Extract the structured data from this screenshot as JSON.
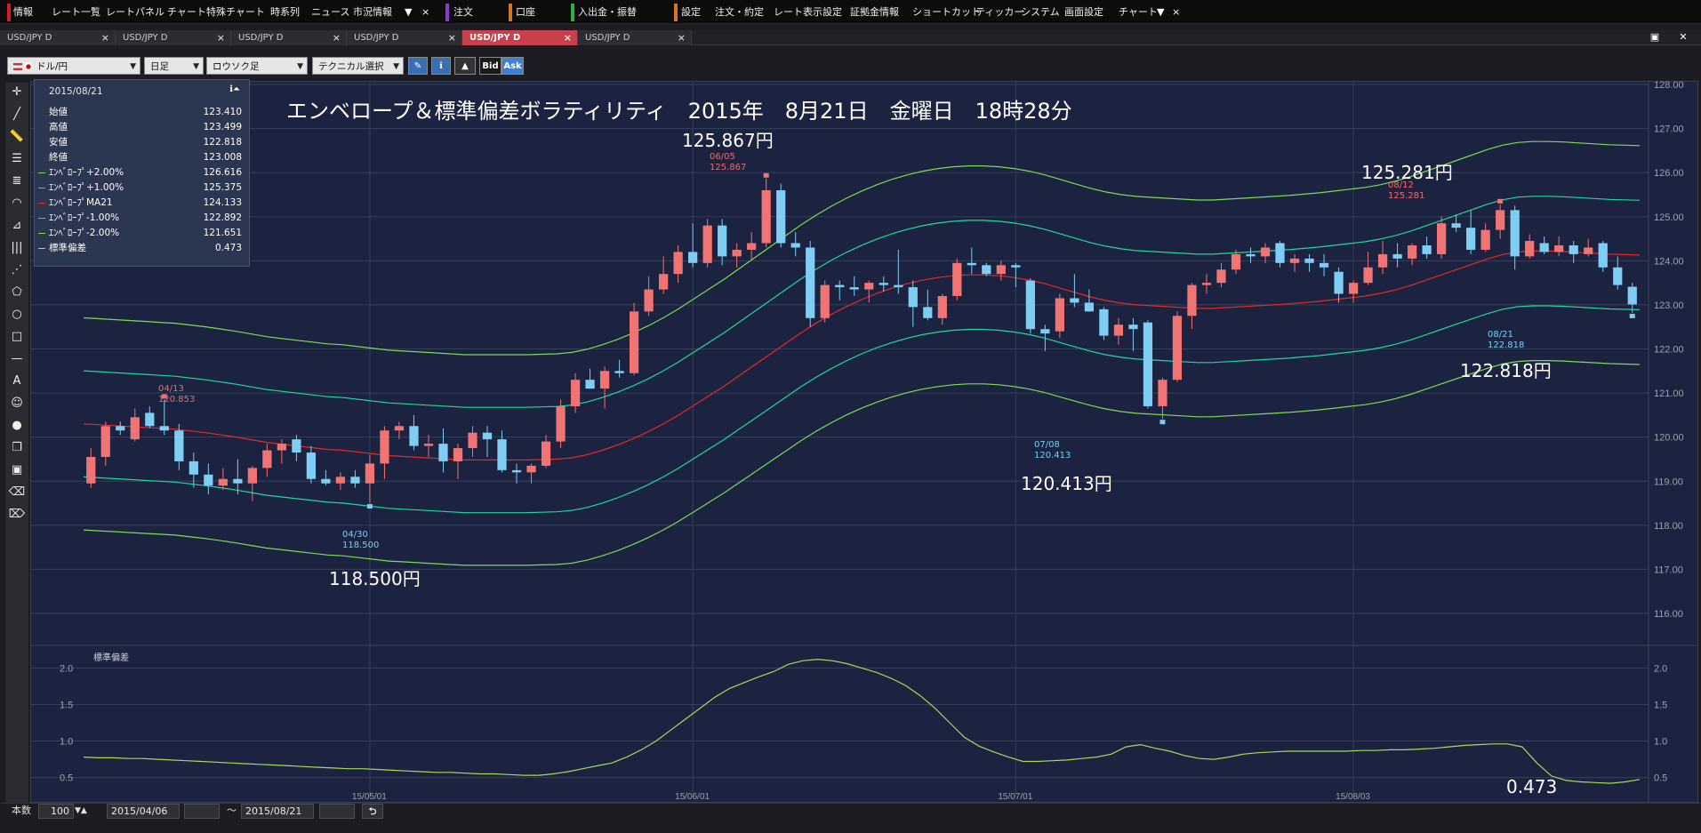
{
  "menubar": {
    "items": [
      "情報",
      "レート一覧",
      "レートパネル",
      "チャート",
      "特殊チャート",
      "時系列",
      "ニュース",
      "市況情報",
      "注文",
      "口座",
      "入出金・振替",
      "設定",
      "注文・約定",
      "レート表示設定",
      "証拠金情報",
      "ショートカット",
      "ティッカー",
      "システム",
      "画面設定",
      "チャート"
    ],
    "overflow_icon": "▼",
    "close_icon": "×"
  },
  "tabs": [
    {
      "label": "USD/JPY D",
      "active": false
    },
    {
      "label": "USD/JPY D",
      "active": false
    },
    {
      "label": "USD/JPY D",
      "active": false
    },
    {
      "label": "USD/JPY D",
      "active": false
    },
    {
      "label": "USD/JPY D",
      "active": true
    },
    {
      "label": "USD/JPY D",
      "active": false
    }
  ],
  "tab_close": "×",
  "toolbar": {
    "currency_pair": "ドル/円",
    "timeframe": "日足",
    "chart_style": "ロウソク足",
    "technical": "テクニカル選択",
    "bid": "Bid",
    "ask": "Ask"
  },
  "info_panel": {
    "date": "2015/08/21",
    "rows": [
      {
        "label": "始値",
        "value": "123.410",
        "color": ""
      },
      {
        "label": "高値",
        "value": "123.499",
        "color": ""
      },
      {
        "label": "安値",
        "value": "122.818",
        "color": ""
      },
      {
        "label": "終値",
        "value": "123.008",
        "color": ""
      },
      {
        "label": "ｴﾝﾍﾞﾛｰﾌﾟ+2.00%",
        "value": "126.616",
        "color": "#7ed957"
      },
      {
        "label": "ｴﾝﾍﾞﾛｰﾌﾟ+1.00%",
        "value": "125.375",
        "color": "#22d6a0"
      },
      {
        "label": "ｴﾝﾍﾞﾛｰﾌﾟMA21",
        "value": "124.133",
        "color": "#e02a2a"
      },
      {
        "label": "ｴﾝﾍﾞﾛｰﾌﾟ-1.00%",
        "value": "122.892",
        "color": "#22d6a0"
      },
      {
        "label": "ｴﾝﾍﾞﾛｰﾌﾟ-2.00%",
        "value": "121.651",
        "color": "#7ed957"
      },
      {
        "label": "標準偏差",
        "value": "0.473",
        "color": "#a9d85a"
      }
    ]
  },
  "title": "エンベロープ＆標準偏差ボラティリティ　2015年　8月21日　金曜日　18時28分",
  "annotations": {
    "high_0605": {
      "text": "125.867円",
      "date": "06/05",
      "price": "125.867"
    },
    "high_0812": {
      "text": "125.281円",
      "date": "08/12",
      "price": "125.281"
    },
    "high_0413": {
      "date": "04/13",
      "price": "120.853"
    },
    "low_0430": {
      "text": "118.500円",
      "date": "04/30",
      "price": "118.500"
    },
    "low_0708": {
      "text": "120.413円",
      "date": "07/08",
      "price": "120.413"
    },
    "last_0821": {
      "text": "122.818円",
      "date": "08/21",
      "price": "122.818"
    },
    "sd_last": {
      "text": "0.473"
    }
  },
  "sub_panel_label": "標準偏差",
  "statusbar": {
    "count_label": "本数",
    "count_value": "100",
    "start_date": "2015/04/06",
    "tilde": "～",
    "end_date": "2015/08/21"
  },
  "colors": {
    "background": "#1b2340",
    "up_candle": "#f07474",
    "down_candle": "#7fcdf2",
    "ma": "#e02a2a",
    "env1": "#22d6a0",
    "env2": "#7ed957",
    "sd": "#a9d85a"
  },
  "chart_data": {
    "type": "candlestick",
    "x_tick_labels": [
      "15/05/01",
      "15/06/01",
      "15/07/01",
      "15/08/03"
    ],
    "y_ticks_main": [
      "116.00",
      "117.00",
      "118.00",
      "119.00",
      "120.00",
      "121.00",
      "122.00",
      "123.00",
      "124.00",
      "125.00",
      "126.00",
      "127.00",
      "128.00"
    ],
    "ylim_main": [
      116,
      128
    ],
    "y_ticks_sub": [
      "0.5",
      "1.0",
      "1.5",
      "2.0"
    ],
    "ylim_sub": [
      0.3,
      2.2
    ],
    "ohlc": [
      {
        "o": 118.95,
        "h": 119.75,
        "l": 118.85,
        "c": 119.55
      },
      {
        "o": 119.55,
        "h": 120.35,
        "l": 119.35,
        "c": 120.25
      },
      {
        "o": 120.25,
        "h": 120.35,
        "l": 120.05,
        "c": 120.15
      },
      {
        "o": 119.95,
        "h": 120.65,
        "l": 119.9,
        "c": 120.45
      },
      {
        "o": 120.55,
        "h": 120.7,
        "l": 120.2,
        "c": 120.25
      },
      {
        "o": 120.25,
        "h": 120.85,
        "l": 120.05,
        "c": 120.15
      },
      {
        "o": 120.15,
        "h": 120.3,
        "l": 119.25,
        "c": 119.45
      },
      {
        "o": 119.45,
        "h": 119.65,
        "l": 118.85,
        "c": 119.15
      },
      {
        "o": 119.15,
        "h": 119.4,
        "l": 118.7,
        "c": 118.9
      },
      {
        "o": 118.9,
        "h": 119.3,
        "l": 118.8,
        "c": 119.05
      },
      {
        "o": 119.05,
        "h": 119.5,
        "l": 118.7,
        "c": 118.95
      },
      {
        "o": 118.95,
        "h": 119.35,
        "l": 118.55,
        "c": 119.3
      },
      {
        "o": 119.3,
        "h": 119.85,
        "l": 119.1,
        "c": 119.7
      },
      {
        "o": 119.7,
        "h": 119.95,
        "l": 119.4,
        "c": 119.85
      },
      {
        "o": 119.95,
        "h": 120.05,
        "l": 119.45,
        "c": 119.65
      },
      {
        "o": 119.65,
        "h": 119.8,
        "l": 118.95,
        "c": 119.05
      },
      {
        "o": 119.05,
        "h": 119.25,
        "l": 118.9,
        "c": 118.95
      },
      {
        "o": 118.95,
        "h": 119.2,
        "l": 118.8,
        "c": 119.1
      },
      {
        "o": 119.1,
        "h": 119.25,
        "l": 118.85,
        "c": 118.95
      },
      {
        "o": 118.95,
        "h": 119.6,
        "l": 118.5,
        "c": 119.4
      },
      {
        "o": 119.4,
        "h": 120.25,
        "l": 119.05,
        "c": 120.15
      },
      {
        "o": 120.15,
        "h": 120.35,
        "l": 119.95,
        "c": 120.25
      },
      {
        "o": 120.25,
        "h": 120.5,
        "l": 119.7,
        "c": 119.8
      },
      {
        "o": 119.8,
        "h": 120.05,
        "l": 119.55,
        "c": 119.85
      },
      {
        "o": 119.85,
        "h": 120.2,
        "l": 119.2,
        "c": 119.45
      },
      {
        "o": 119.45,
        "h": 119.85,
        "l": 119.05,
        "c": 119.75
      },
      {
        "o": 119.75,
        "h": 120.25,
        "l": 119.55,
        "c": 120.1
      },
      {
        "o": 120.1,
        "h": 120.25,
        "l": 119.55,
        "c": 119.95
      },
      {
        "o": 119.95,
        "h": 120.15,
        "l": 119.2,
        "c": 119.25
      },
      {
        "o": 119.25,
        "h": 119.4,
        "l": 118.95,
        "c": 119.2
      },
      {
        "o": 119.2,
        "h": 119.4,
        "l": 118.95,
        "c": 119.35
      },
      {
        "o": 119.35,
        "h": 120.05,
        "l": 119.3,
        "c": 119.9
      },
      {
        "o": 119.9,
        "h": 120.85,
        "l": 119.75,
        "c": 120.7
      },
      {
        "o": 120.7,
        "h": 121.45,
        "l": 120.55,
        "c": 121.3
      },
      {
        "o": 121.3,
        "h": 121.55,
        "l": 121.1,
        "c": 121.1
      },
      {
        "o": 121.1,
        "h": 121.6,
        "l": 120.65,
        "c": 121.5
      },
      {
        "o": 121.5,
        "h": 121.75,
        "l": 121.35,
        "c": 121.45
      },
      {
        "o": 121.45,
        "h": 123.05,
        "l": 121.4,
        "c": 122.85
      },
      {
        "o": 122.85,
        "h": 123.65,
        "l": 122.75,
        "c": 123.35
      },
      {
        "o": 123.35,
        "h": 124.1,
        "l": 123.25,
        "c": 123.7
      },
      {
        "o": 123.7,
        "h": 124.35,
        "l": 123.5,
        "c": 124.2
      },
      {
        "o": 124.2,
        "h": 124.85,
        "l": 123.85,
        "c": 123.95
      },
      {
        "o": 123.95,
        "h": 124.95,
        "l": 123.85,
        "c": 124.8
      },
      {
        "o": 124.8,
        "h": 124.95,
        "l": 123.9,
        "c": 124.1
      },
      {
        "o": 124.1,
        "h": 124.4,
        "l": 123.85,
        "c": 124.25
      },
      {
        "o": 124.25,
        "h": 124.65,
        "l": 124.0,
        "c": 124.4
      },
      {
        "o": 124.4,
        "h": 125.87,
        "l": 124.3,
        "c": 125.6
      },
      {
        "o": 125.6,
        "h": 125.75,
        "l": 124.3,
        "c": 124.4
      },
      {
        "o": 124.4,
        "h": 124.65,
        "l": 124.1,
        "c": 124.3
      },
      {
        "o": 124.3,
        "h": 124.45,
        "l": 122.5,
        "c": 122.7
      },
      {
        "o": 122.7,
        "h": 123.55,
        "l": 122.6,
        "c": 123.45
      },
      {
        "o": 123.45,
        "h": 123.55,
        "l": 123.1,
        "c": 123.4
      },
      {
        "o": 123.4,
        "h": 123.65,
        "l": 123.2,
        "c": 123.35
      },
      {
        "o": 123.35,
        "h": 123.55,
        "l": 123.05,
        "c": 123.5
      },
      {
        "o": 123.5,
        "h": 123.65,
        "l": 123.3,
        "c": 123.45
      },
      {
        "o": 123.45,
        "h": 124.25,
        "l": 123.25,
        "c": 123.4
      },
      {
        "o": 123.4,
        "h": 123.55,
        "l": 122.5,
        "c": 122.95
      },
      {
        "o": 122.95,
        "h": 123.35,
        "l": 122.65,
        "c": 122.7
      },
      {
        "o": 122.7,
        "h": 123.25,
        "l": 122.55,
        "c": 123.2
      },
      {
        "o": 123.2,
        "h": 124.05,
        "l": 123.1,
        "c": 123.95
      },
      {
        "o": 123.95,
        "h": 124.3,
        "l": 123.7,
        "c": 123.9
      },
      {
        "o": 123.9,
        "h": 123.95,
        "l": 123.65,
        "c": 123.7
      },
      {
        "o": 123.7,
        "h": 124.0,
        "l": 123.55,
        "c": 123.9
      },
      {
        "o": 123.9,
        "h": 123.95,
        "l": 123.4,
        "c": 123.85
      },
      {
        "o": 123.55,
        "h": 123.6,
        "l": 122.35,
        "c": 122.45
      },
      {
        "o": 122.45,
        "h": 122.55,
        "l": 121.95,
        "c": 122.35
      },
      {
        "o": 122.4,
        "h": 123.25,
        "l": 122.25,
        "c": 123.15
      },
      {
        "o": 123.15,
        "h": 123.7,
        "l": 122.95,
        "c": 123.05
      },
      {
        "o": 123.05,
        "h": 123.35,
        "l": 122.85,
        "c": 122.85
      },
      {
        "o": 122.9,
        "h": 122.95,
        "l": 122.2,
        "c": 122.3
      },
      {
        "o": 122.3,
        "h": 122.7,
        "l": 122.1,
        "c": 122.55
      },
      {
        "o": 122.55,
        "h": 122.7,
        "l": 121.95,
        "c": 122.45
      },
      {
        "o": 122.6,
        "h": 122.65,
        "l": 120.65,
        "c": 120.7
      },
      {
        "o": 120.7,
        "h": 121.35,
        "l": 120.41,
        "c": 121.3
      },
      {
        "o": 121.3,
        "h": 122.85,
        "l": 121.25,
        "c": 122.75
      },
      {
        "o": 122.75,
        "h": 123.5,
        "l": 122.45,
        "c": 123.45
      },
      {
        "o": 123.45,
        "h": 123.7,
        "l": 123.25,
        "c": 123.5
      },
      {
        "o": 123.5,
        "h": 123.95,
        "l": 123.4,
        "c": 123.8
      },
      {
        "o": 123.8,
        "h": 124.25,
        "l": 123.7,
        "c": 124.15
      },
      {
        "o": 124.15,
        "h": 124.3,
        "l": 123.95,
        "c": 124.1
      },
      {
        "o": 124.1,
        "h": 124.4,
        "l": 123.95,
        "c": 124.3
      },
      {
        "o": 124.4,
        "h": 124.45,
        "l": 123.85,
        "c": 123.95
      },
      {
        "o": 123.95,
        "h": 124.15,
        "l": 123.75,
        "c": 124.05
      },
      {
        "o": 124.05,
        "h": 124.15,
        "l": 123.75,
        "c": 123.95
      },
      {
        "o": 123.95,
        "h": 124.15,
        "l": 123.65,
        "c": 123.85
      },
      {
        "o": 123.75,
        "h": 123.85,
        "l": 123.05,
        "c": 123.25
      },
      {
        "o": 123.25,
        "h": 123.55,
        "l": 123.05,
        "c": 123.5
      },
      {
        "o": 123.5,
        "h": 124.2,
        "l": 123.45,
        "c": 123.85
      },
      {
        "o": 123.85,
        "h": 124.45,
        "l": 123.7,
        "c": 124.15
      },
      {
        "o": 124.15,
        "h": 124.4,
        "l": 123.85,
        "c": 124.05
      },
      {
        "o": 124.05,
        "h": 124.4,
        "l": 123.9,
        "c": 124.35
      },
      {
        "o": 124.35,
        "h": 124.55,
        "l": 124.05,
        "c": 124.15
      },
      {
        "o": 124.15,
        "h": 125.0,
        "l": 124.05,
        "c": 124.85
      },
      {
        "o": 124.85,
        "h": 125.05,
        "l": 124.65,
        "c": 124.75
      },
      {
        "o": 124.75,
        "h": 125.15,
        "l": 124.15,
        "c": 124.25
      },
      {
        "o": 124.25,
        "h": 124.85,
        "l": 124.2,
        "c": 124.7
      },
      {
        "o": 124.7,
        "h": 125.28,
        "l": 124.5,
        "c": 125.15
      },
      {
        "o": 125.15,
        "h": 125.25,
        "l": 123.8,
        "c": 124.1
      },
      {
        "o": 124.1,
        "h": 124.6,
        "l": 124.05,
        "c": 124.45
      },
      {
        "o": 124.4,
        "h": 124.55,
        "l": 124.15,
        "c": 124.2
      },
      {
        "o": 124.2,
        "h": 124.55,
        "l": 124.1,
        "c": 124.35
      },
      {
        "o": 124.35,
        "h": 124.45,
        "l": 123.95,
        "c": 124.15
      },
      {
        "o": 124.15,
        "h": 124.5,
        "l": 124.1,
        "c": 124.3
      },
      {
        "o": 124.4,
        "h": 124.45,
        "l": 123.75,
        "c": 123.85
      },
      {
        "o": 123.85,
        "h": 124.1,
        "l": 123.35,
        "c": 123.45
      },
      {
        "o": 123.41,
        "h": 123.5,
        "l": 122.82,
        "c": 123.01
      }
    ],
    "ma21": [
      120.3,
      120.28,
      120.26,
      120.24,
      120.22,
      120.2,
      120.18,
      120.14,
      120.1,
      120.05,
      120.0,
      119.94,
      119.88,
      119.84,
      119.8,
      119.76,
      119.72,
      119.7,
      119.66,
      119.62,
      119.58,
      119.56,
      119.54,
      119.52,
      119.5,
      119.48,
      119.48,
      119.48,
      119.48,
      119.48,
      119.49,
      119.5,
      119.53,
      119.6,
      119.7,
      119.82,
      119.96,
      120.12,
      120.3,
      120.5,
      120.72,
      120.94,
      121.16,
      121.4,
      121.64,
      121.88,
      122.12,
      122.36,
      122.58,
      122.78,
      122.96,
      123.12,
      123.26,
      123.38,
      123.48,
      123.56,
      123.62,
      123.66,
      123.68,
      123.68,
      123.66,
      123.62,
      123.56,
      123.48,
      123.38,
      123.28,
      123.18,
      123.1,
      123.04,
      123.0,
      122.98,
      122.96,
      122.94,
      122.92,
      122.92,
      122.94,
      122.96,
      122.98,
      123.0,
      123.02,
      123.05,
      123.08,
      123.12,
      123.16,
      123.2,
      123.26,
      123.34,
      123.44,
      123.56,
      123.68,
      123.8,
      123.92,
      124.04,
      124.14,
      124.2,
      124.22,
      124.22,
      124.21,
      124.19,
      124.17,
      124.15,
      124.14,
      124.13
    ],
    "env_pct": [
      2,
      1,
      -1,
      -2
    ],
    "sd": [
      0.78,
      0.77,
      0.77,
      0.76,
      0.76,
      0.75,
      0.74,
      0.73,
      0.72,
      0.71,
      0.7,
      0.69,
      0.68,
      0.67,
      0.66,
      0.65,
      0.64,
      0.63,
      0.62,
      0.62,
      0.61,
      0.6,
      0.59,
      0.58,
      0.57,
      0.57,
      0.56,
      0.55,
      0.55,
      0.54,
      0.53,
      0.53,
      0.55,
      0.58,
      0.62,
      0.66,
      0.7,
      0.78,
      0.88,
      1.0,
      1.15,
      1.3,
      1.45,
      1.6,
      1.72,
      1.8,
      1.88,
      1.95,
      2.05,
      2.1,
      2.12,
      2.1,
      2.06,
      2.0,
      1.94,
      1.86,
      1.76,
      1.62,
      1.45,
      1.25,
      1.05,
      0.93,
      0.85,
      0.78,
      0.72,
      0.72,
      0.73,
      0.74,
      0.76,
      0.78,
      0.82,
      0.92,
      0.95,
      0.9,
      0.86,
      0.8,
      0.76,
      0.75,
      0.78,
      0.82,
      0.84,
      0.85,
      0.86,
      0.86,
      0.86,
      0.86,
      0.86,
      0.87,
      0.87,
      0.88,
      0.88,
      0.89,
      0.9,
      0.92,
      0.94,
      0.95,
      0.96,
      0.96,
      0.92,
      0.7,
      0.52,
      0.46,
      0.44,
      0.43,
      0.42,
      0.44,
      0.473
    ]
  }
}
